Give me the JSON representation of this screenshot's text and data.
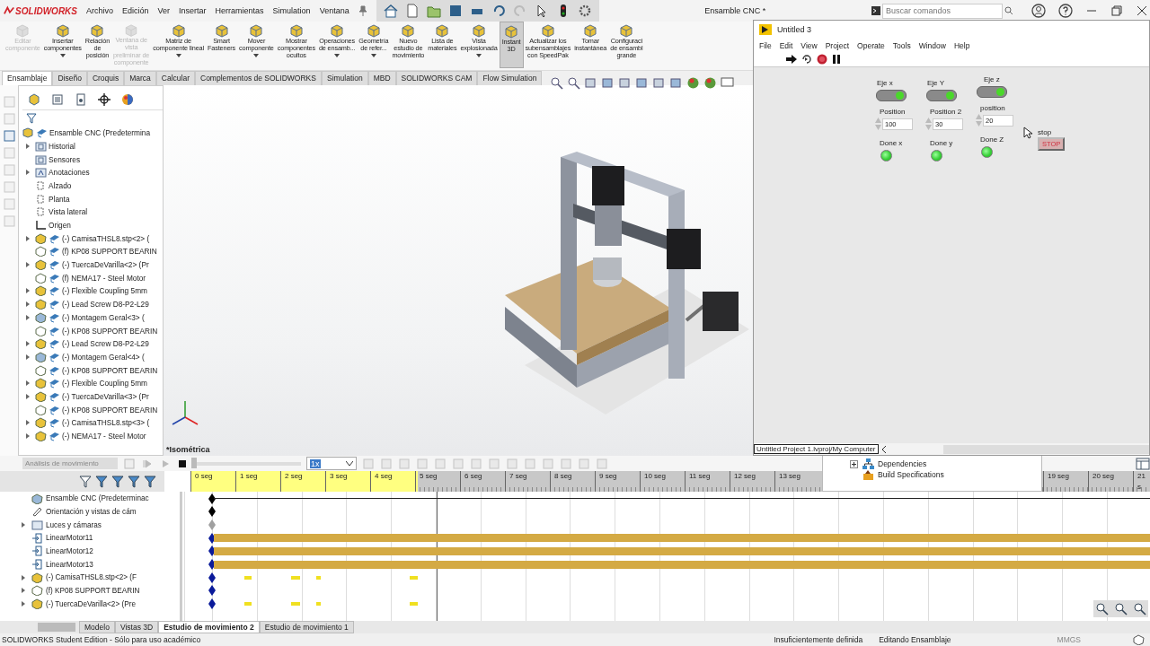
{
  "app": {
    "logo": "SOLIDWORKS",
    "menu": [
      "Archivo",
      "Edición",
      "Ver",
      "Insertar",
      "Herramientas",
      "Simulation",
      "Ventana"
    ],
    "title": "Ensamble CNC *",
    "search": {
      "placeholder": "Buscar comandos"
    }
  },
  "ribbon": [
    {
      "label": "Editar\ncomponente",
      "disabled": true,
      "dropdown": false,
      "selected": false
    },
    {
      "label": "Insertar\ncomponentes",
      "disabled": false,
      "dropdown": true,
      "selected": false
    },
    {
      "label": "Relación\nde\nposición",
      "disabled": false,
      "dropdown": false,
      "selected": false
    },
    {
      "label": "Ventana de\nvista\npreliminar de\ncomponente",
      "disabled": true,
      "dropdown": false,
      "selected": false
    },
    {
      "label": "Matriz de\ncomponente lineal",
      "disabled": false,
      "dropdown": true,
      "selected": false
    },
    {
      "label": "Smart\nFasteners",
      "disabled": false,
      "dropdown": false,
      "selected": false
    },
    {
      "label": "Mover\ncomponente",
      "disabled": false,
      "dropdown": true,
      "selected": false
    },
    {
      "label": "Mostrar\ncomponentes\nocultos",
      "disabled": false,
      "dropdown": false,
      "selected": false
    },
    {
      "label": "Operaciones\nde ensamb...",
      "disabled": false,
      "dropdown": true,
      "selected": false
    },
    {
      "label": "Geometría\nde refer...",
      "disabled": false,
      "dropdown": true,
      "selected": false
    },
    {
      "label": "Nuevo\nestudio de\nmovimiento",
      "disabled": false,
      "dropdown": false,
      "selected": false
    },
    {
      "label": "Lista de\nmateriales",
      "disabled": false,
      "dropdown": false,
      "selected": false
    },
    {
      "label": "Vista\nexplosionada",
      "disabled": false,
      "dropdown": true,
      "selected": false
    },
    {
      "label": "Instant\n3D",
      "disabled": false,
      "dropdown": false,
      "selected": true
    },
    {
      "label": "Actualizar los\nsubensamblajes\ncon SpeedPak",
      "disabled": false,
      "dropdown": false,
      "selected": false
    },
    {
      "label": "Tomar\ninstantánea",
      "disabled": false,
      "dropdown": false,
      "selected": false
    },
    {
      "label": "Configuraci\nde ensambl\ngrande",
      "disabled": false,
      "dropdown": false,
      "selected": false
    }
  ],
  "ribbon_tabs": [
    {
      "label": "Ensamblaje",
      "selected": true
    },
    {
      "label": "Diseño",
      "selected": false
    },
    {
      "label": "Croquis",
      "selected": false
    },
    {
      "label": "Marca",
      "selected": false
    },
    {
      "label": "Calcular",
      "selected": false
    },
    {
      "label": "Complementos de SOLIDWORKS",
      "selected": false
    },
    {
      "label": "Simulation",
      "selected": false
    },
    {
      "label": "MBD",
      "selected": false
    },
    {
      "label": "SOLIDWORKS CAM",
      "selected": false
    },
    {
      "label": "Flow Simulation",
      "selected": false
    }
  ],
  "tree": {
    "root": "Ensamble CNC  (Predetermina",
    "items": [
      {
        "label": "Historial",
        "kind": "folder",
        "expandable": true
      },
      {
        "label": "Sensores",
        "kind": "folder",
        "expandable": false
      },
      {
        "label": "Anotaciones",
        "kind": "annotation",
        "expandable": true
      },
      {
        "label": "Alzado",
        "kind": "plane",
        "expandable": false
      },
      {
        "label": "Planta",
        "kind": "plane",
        "expandable": false
      },
      {
        "label": "Vista lateral",
        "kind": "plane",
        "expandable": false
      },
      {
        "label": "Origen",
        "kind": "origin",
        "expandable": false
      },
      {
        "label": "(-) CamisaTHSL8.stp<2> (",
        "kind": "part",
        "expandable": true
      },
      {
        "label": "(f) KP08 SUPPORT BEARIN",
        "kind": "fixed",
        "expandable": false
      },
      {
        "label": "(-) TuercaDeVarilla<2> (Pr",
        "kind": "part",
        "expandable": true
      },
      {
        "label": "(f) NEMA17 - Steel Motor",
        "kind": "fixed",
        "expandable": false
      },
      {
        "label": "(-) Flexible Coupling 5mm",
        "kind": "part",
        "expandable": true
      },
      {
        "label": "(-) Lead Screw D8-P2-L29",
        "kind": "part",
        "expandable": true
      },
      {
        "label": "(-) Montagem Geral<3> (",
        "kind": "assembly",
        "expandable": true
      },
      {
        "label": "(-) KP08 SUPPORT BEARIN",
        "kind": "fixed",
        "expandable": false
      },
      {
        "label": "(-) Lead Screw D8-P2-L29",
        "kind": "part",
        "expandable": true
      },
      {
        "label": "(-) Montagem Geral<4> (",
        "kind": "assembly",
        "expandable": true
      },
      {
        "label": "(-) KP08 SUPPORT BEARIN",
        "kind": "fixed",
        "expandable": false
      },
      {
        "label": "(-) Flexible Coupling 5mm",
        "kind": "part",
        "expandable": true
      },
      {
        "label": "(-) TuercaDeVarilla<3> (Pr",
        "kind": "part",
        "expandable": true
      },
      {
        "label": "(-) KP08 SUPPORT BEARIN",
        "kind": "fixed",
        "expandable": false
      },
      {
        "label": "(-) CamisaTHSL8.stp<3> (",
        "kind": "part",
        "expandable": true
      },
      {
        "label": "(-) NEMA17 - Steel Motor",
        "kind": "part",
        "expandable": true
      }
    ]
  },
  "view": {
    "label": "*Isométrica"
  },
  "motion": {
    "analysis": "Análisis de movimiento",
    "speed": "1x",
    "ruler_left": [
      "0 seg",
      "1 seg",
      "2 seg",
      "3 seg",
      "4 seg",
      "5 seg",
      "6 seg",
      "7 seg",
      "8 seg",
      "9 seg",
      "10 seg",
      "11 seg",
      "12 seg",
      "13 seg"
    ],
    "ruler_right": [
      "19 seg",
      "20 seg",
      "21 s"
    ],
    "rows": [
      {
        "label": "Ensamble CNC  (Predeterminac",
        "kind": "assembly",
        "expandable": false,
        "bar": false,
        "marks": false,
        "color": "#000000"
      },
      {
        "label": "Orientación y vistas de cám",
        "kind": "camera",
        "expandable": false,
        "bar": false,
        "marks": false,
        "color": "#000000"
      },
      {
        "label": "Luces y cámaras",
        "kind": "folder",
        "expandable": true,
        "bar": false,
        "marks": false,
        "color": "#a0a0a0"
      },
      {
        "label": "LinearMotor11",
        "kind": "motor",
        "expandable": false,
        "bar": true,
        "marks": false,
        "color": "#0a1a9a"
      },
      {
        "label": "LinearMotor12",
        "kind": "motor",
        "expandable": false,
        "bar": true,
        "marks": false,
        "color": "#0a1a9a"
      },
      {
        "label": "LinearMotor13",
        "kind": "motor",
        "expandable": false,
        "bar": true,
        "marks": false,
        "color": "#0a1a9a"
      },
      {
        "label": "(-) CamisaTHSL8.stp<2> (F",
        "kind": "part",
        "expandable": true,
        "bar": false,
        "marks": true,
        "color": "#0a1a9a"
      },
      {
        "label": "(f) KP08 SUPPORT BEARIN",
        "kind": "fixed",
        "expandable": true,
        "bar": false,
        "marks": false,
        "color": "#0a1a9a"
      },
      {
        "label": "(-) TuercaDeVarilla<2> (Pre",
        "kind": "part",
        "expandable": true,
        "bar": false,
        "marks": true,
        "color": "#0a1a9a"
      }
    ],
    "slider": {
      "level": 0
    }
  },
  "bottom_tabs": [
    {
      "label": "Modelo",
      "selected": false
    },
    {
      "label": "Vistas 3D",
      "selected": false
    },
    {
      "label": "Estudio de movimiento 2",
      "selected": true
    },
    {
      "label": "Estudio de movimiento 1",
      "selected": false
    }
  ],
  "status": {
    "edition": "SOLIDWORKS Student Edition - Sólo para uso académico",
    "definition": "Insuficientemente definida",
    "mode": "Editando Ensamblaje",
    "units": "MMGS"
  },
  "labview": {
    "title": "Untitled 3",
    "menu": [
      "File",
      "Edit",
      "View",
      "Project",
      "Operate",
      "Tools",
      "Window",
      "Help"
    ],
    "columns": [
      {
        "toggle_label": "Eje x",
        "on": true,
        "numeric_label": "Position",
        "value": "100",
        "led_label": "Done x",
        "led_on": true
      },
      {
        "toggle_label": "Eje Y",
        "on": true,
        "numeric_label": "Position 2",
        "value": "30",
        "led_label": "Done y",
        "led_on": true
      },
      {
        "toggle_label": "Eje z",
        "on": true,
        "numeric_label": "position",
        "value": "20",
        "led_label": "Done Z",
        "led_on": true
      }
    ],
    "stop": {
      "label": "stop",
      "button": "STOP"
    },
    "path": "Untitled Project 1.lvproj/My Computer"
  },
  "project_tree": [
    {
      "label": "Dependencies",
      "expandable": true
    },
    {
      "label": "Build Specifications",
      "expandable": false
    }
  ]
}
